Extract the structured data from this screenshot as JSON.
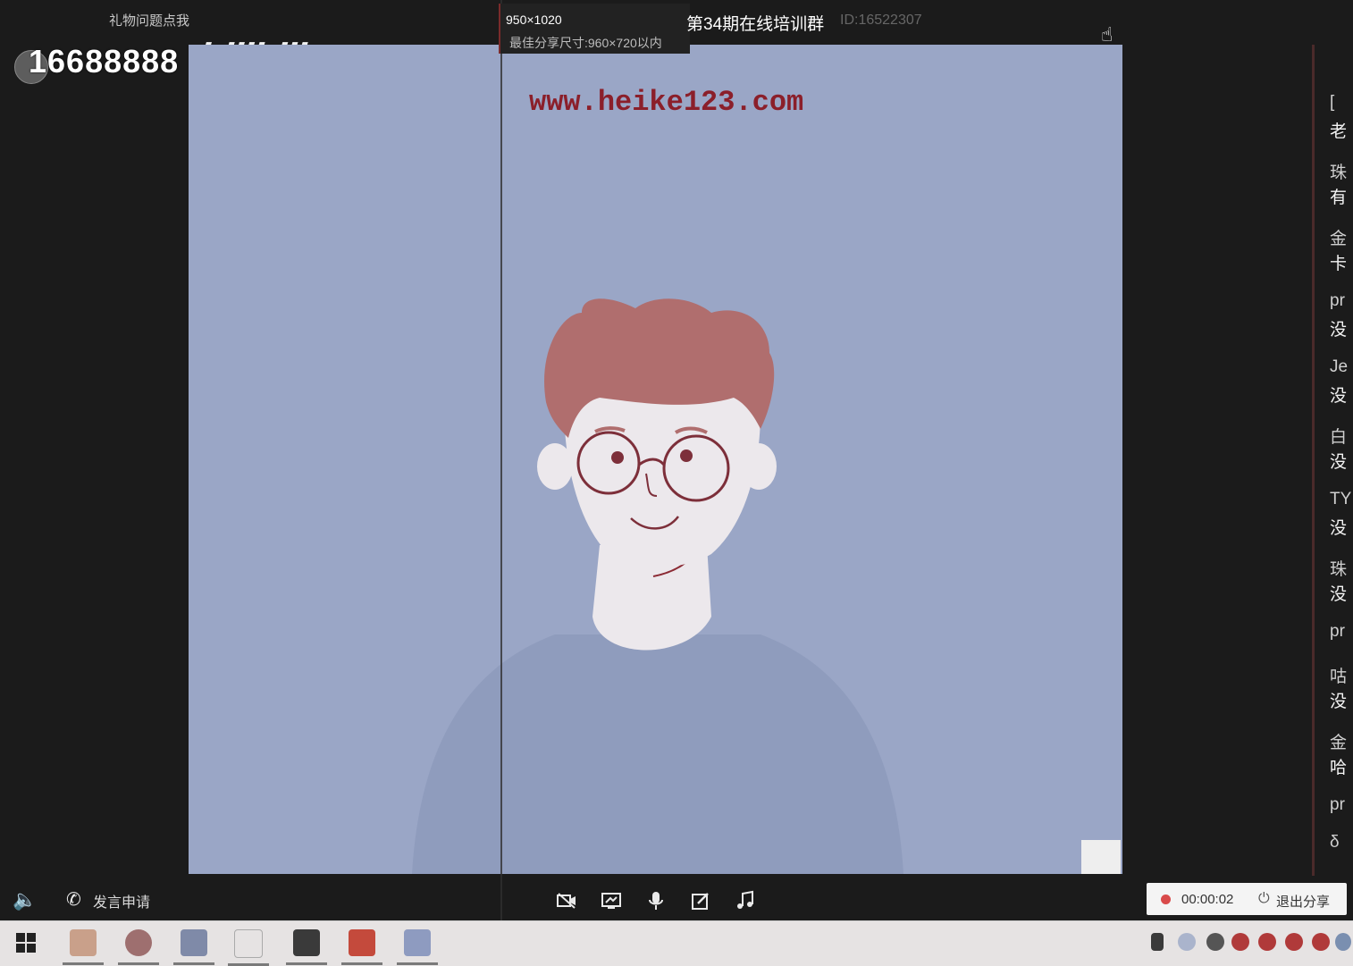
{
  "overlay": {
    "gift_link": "礼物问题点我",
    "room_number": "16688888",
    "logo_text": "bilibili"
  },
  "top_bar": {
    "size_text": "950×1020",
    "size_hint": "最佳分享尺寸:960×720以内",
    "group_title": "第34期在线培训群",
    "group_id": "ID:16522307"
  },
  "share": {
    "watermark": "www.heike123.com"
  },
  "chat": {
    "lines": [
      {
        "text": "[",
        "msg": false
      },
      {
        "text": "老",
        "msg": true
      },
      {
        "text": "珠",
        "msg": false
      },
      {
        "text": "有",
        "msg": true
      },
      {
        "text": "金",
        "msg": false
      },
      {
        "text": "卡",
        "msg": true
      },
      {
        "text": "pr",
        "msg": false
      },
      {
        "text": "没",
        "msg": true
      },
      {
        "text": "Je",
        "msg": false
      },
      {
        "text": "没",
        "msg": true
      },
      {
        "text": "白",
        "msg": false
      },
      {
        "text": "没",
        "msg": true
      },
      {
        "text": "TY",
        "msg": false
      },
      {
        "text": "没",
        "msg": true
      },
      {
        "text": "珠",
        "msg": false
      },
      {
        "text": "没",
        "msg": true
      },
      {
        "text": "pr",
        "msg": false
      },
      {
        "text": "咕",
        "msg": false
      },
      {
        "text": "没",
        "msg": true
      },
      {
        "text": "金",
        "msg": false
      },
      {
        "text": "哈",
        "msg": true
      },
      {
        "text": "pr",
        "msg": false
      },
      {
        "text": "δ",
        "msg": false
      }
    ]
  },
  "bottom": {
    "speak_request": "发言申请",
    "recording_time": "00:00:02",
    "exit_share": "退出分享"
  },
  "icons": [
    "speaker-icon",
    "phone-icon",
    "camera-off-icon",
    "screen-share-icon",
    "microphone-icon",
    "annotate-icon",
    "music-icon",
    "power-icon",
    "windows-start-icon"
  ],
  "colors": {
    "share_background": "#9aa6c6",
    "watermark": "#8b1f2a",
    "recording_dot": "#d94a4a",
    "taskbar": "#e6e3e3"
  }
}
